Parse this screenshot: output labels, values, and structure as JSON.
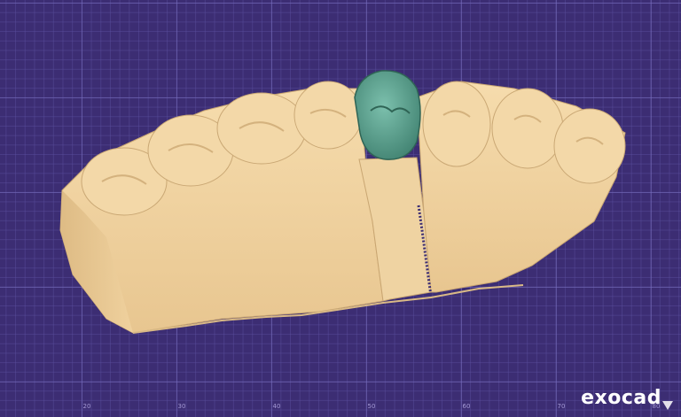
{
  "app": {
    "logo_text": "exocad"
  },
  "axis": {
    "ticks": [
      "20",
      "30",
      "40",
      "50",
      "60",
      "70",
      "80"
    ]
  },
  "scene": {
    "background_color": "#3c2d73",
    "model_color": "#f2d6a6",
    "crown_color": "#5ea391",
    "objects": [
      "jaw-model",
      "crown",
      "die-cut"
    ]
  },
  "icons": {
    "corner": "view-triangle-icon"
  }
}
